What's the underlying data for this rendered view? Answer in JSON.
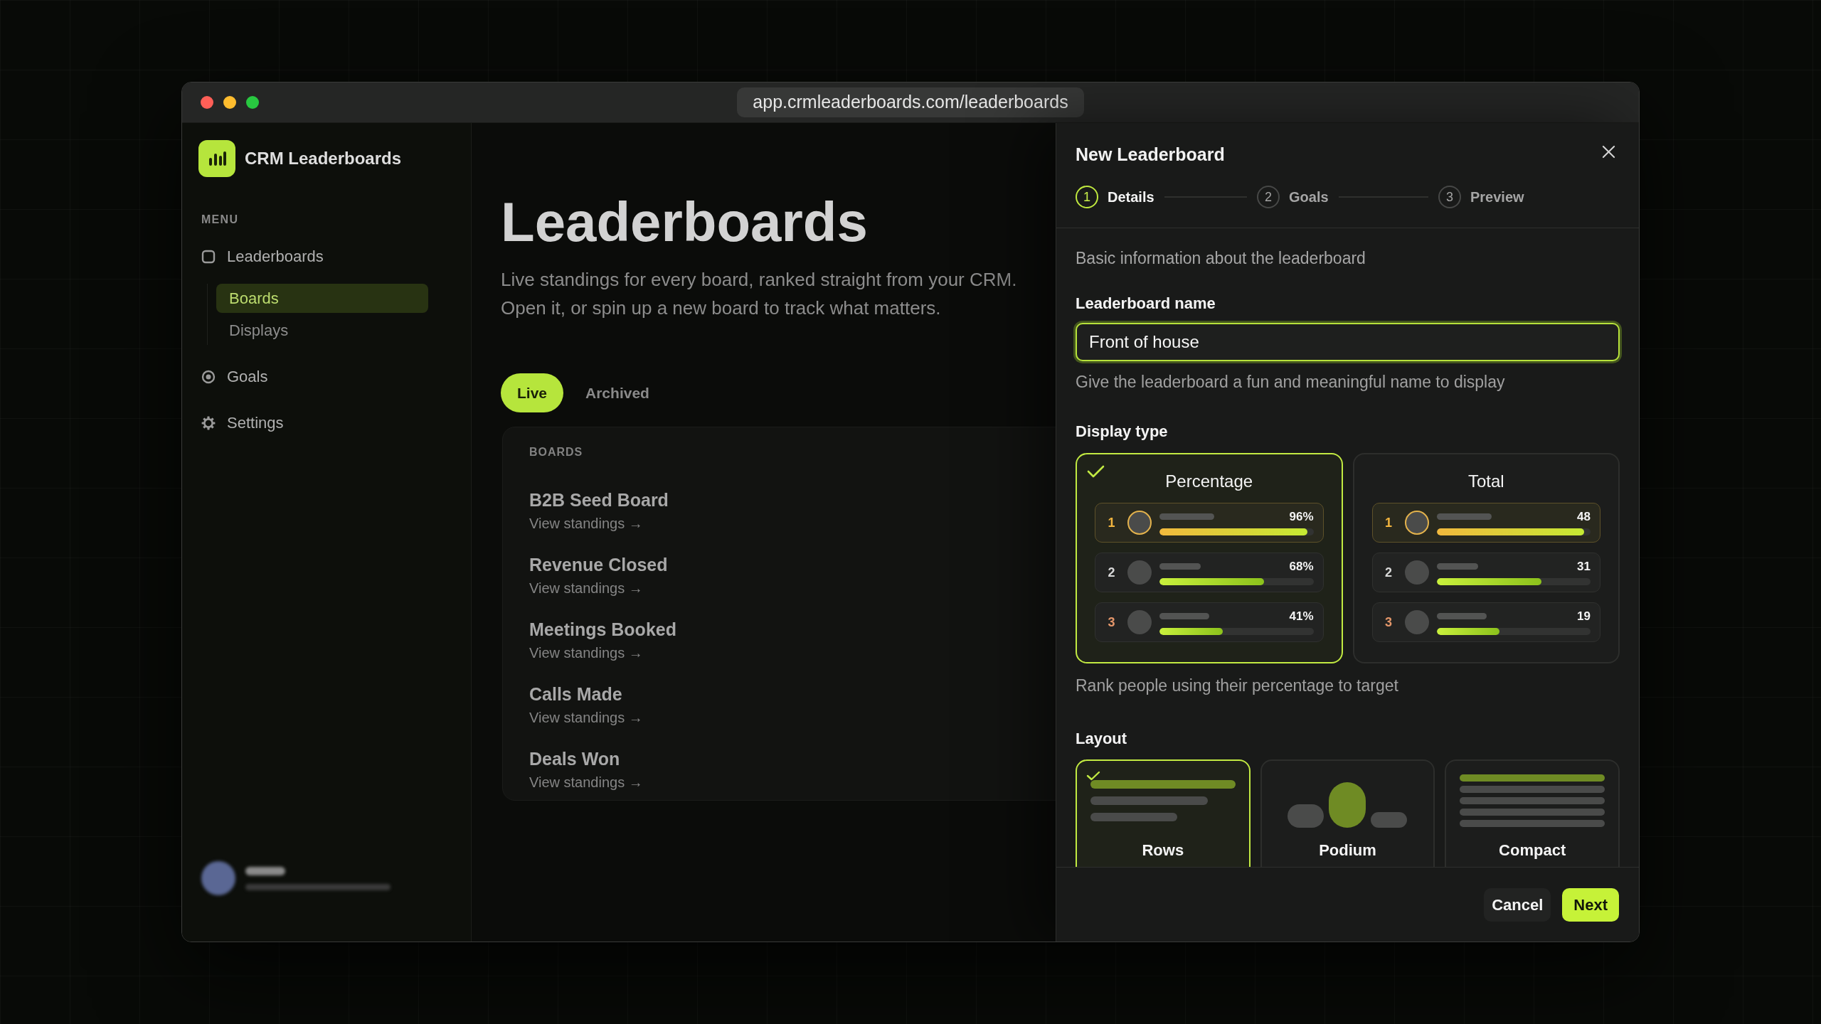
{
  "browser": {
    "url": "app.crmleaderboards.com/leaderboards"
  },
  "sidebar": {
    "app_name": "CRM Leaderboards",
    "section_label": "MENU",
    "items": [
      {
        "label": "Leaderboards",
        "selected": false,
        "children": [
          {
            "label": "Boards",
            "selected": true
          },
          {
            "label": "Displays",
            "selected": false
          }
        ]
      },
      {
        "label": "Goals",
        "selected": false
      },
      {
        "label": "Settings",
        "selected": false
      }
    ]
  },
  "page": {
    "title": "Leaderboards",
    "description": "Live standings for every board, ranked straight from your CRM. Open it, or spin up a new board to track what matters.",
    "tabs": [
      {
        "label": "Live",
        "selected": true
      },
      {
        "label": "Archived",
        "selected": false
      }
    ],
    "boards": {
      "heading": "BOARDS",
      "rows": [
        {
          "name": "B2B Seed Board",
          "link": "View standings →"
        },
        {
          "name": "Revenue Closed",
          "link": "View standings →"
        },
        {
          "name": "Meetings Booked",
          "link": "View standings →"
        },
        {
          "name": "Calls Made",
          "link": "View standings →"
        },
        {
          "name": "Deals Won",
          "link": "View standings →"
        }
      ]
    }
  },
  "dialog": {
    "title": "New Leaderboard",
    "steps": [
      {
        "number": "1",
        "label": "Details",
        "selected": true
      },
      {
        "number": "2",
        "label": "Goals",
        "selected": false
      },
      {
        "number": "3",
        "label": "Preview",
        "selected": false
      }
    ],
    "intro": "Basic information about the leaderboard",
    "name_field": {
      "label": "Leaderboard name",
      "value": "Front of house",
      "focused": true,
      "helper": "Give the leaderboard a fun and meaningful name to display"
    },
    "display_type": {
      "label": "Display type",
      "options": [
        {
          "title": "Percentage",
          "selected": true,
          "rows": [
            {
              "rank": "1",
              "color": "#f2b53f",
              "highlighted": true,
              "value": "96%",
              "level": 0.96
            },
            {
              "rank": "2",
              "color": "#d8d8d8",
              "highlighted": false,
              "value": "68%",
              "level": 0.68
            },
            {
              "rank": "3",
              "color": "#e3966a",
              "highlighted": false,
              "value": "41%",
              "level": 0.41
            }
          ]
        },
        {
          "title": "Total",
          "selected": false,
          "rows": [
            {
              "rank": "1",
              "color": "#f2b53f",
              "highlighted": true,
              "value": "48",
              "level": 0.96
            },
            {
              "rank": "2",
              "color": "#d8d8d8",
              "highlighted": false,
              "value": "31",
              "level": 0.68
            },
            {
              "rank": "3",
              "color": "#e3966a",
              "highlighted": false,
              "value": "19",
              "level": 0.41
            }
          ]
        }
      ],
      "helper": "Rank people using their percentage to target"
    },
    "layout": {
      "label": "Layout",
      "options": [
        {
          "kind": "rows",
          "label": "Rows",
          "selected": true
        },
        {
          "kind": "podium",
          "label": "Podium",
          "selected": false
        },
        {
          "kind": "compact",
          "label": "Compact",
          "selected": false
        }
      ]
    },
    "buttons": [
      {
        "label": "Cancel",
        "kind": "secondary"
      },
      {
        "label": "Next",
        "kind": "primary"
      }
    ]
  }
}
